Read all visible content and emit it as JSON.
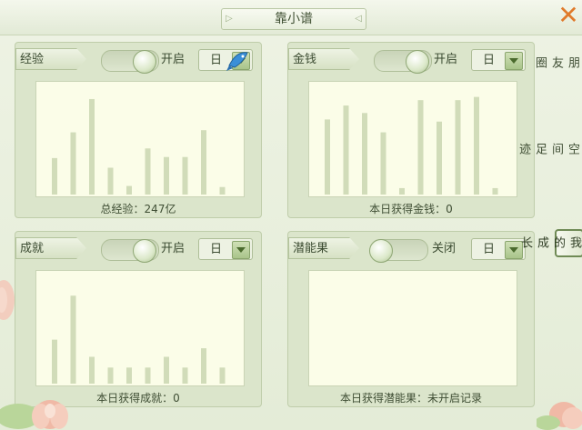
{
  "window": {
    "title": "靠小谱"
  },
  "side_tabs": [
    {
      "label": "朋友圈",
      "active": false
    },
    {
      "label": "空间足迹",
      "active": false
    },
    {
      "label": "我的成长",
      "active": true
    }
  ],
  "panels": {
    "exp": {
      "label": "经验",
      "toggle_label": "开启",
      "toggle_on": true,
      "period": "日",
      "caption": "总经验：247亿",
      "bars": [
        0.34,
        0.58,
        0.89,
        0.25,
        0.08,
        0.43,
        0.35,
        0.35,
        0.6,
        0.07
      ]
    },
    "money": {
      "label": "金钱",
      "toggle_label": "开启",
      "toggle_on": true,
      "period": "日",
      "caption": "本日获得金钱：0",
      "bars": [
        0.7,
        0.83,
        0.76,
        0.58,
        0.06,
        0.88,
        0.68,
        0.88,
        0.91,
        0.06
      ]
    },
    "achieve": {
      "label": "成就",
      "toggle_label": "开启",
      "toggle_on": true,
      "period": "日",
      "caption": "本日获得成就：0",
      "bars": [
        0.41,
        0.82,
        0.25,
        0.15,
        0.15,
        0.15,
        0.25,
        0.15,
        0.33,
        0.15
      ]
    },
    "potential": {
      "label": "潜能果",
      "toggle_label": "关闭",
      "toggle_on": false,
      "period": "日",
      "caption": "本日获得潜能果：未开启记录",
      "bars": []
    }
  },
  "colors": {
    "bar": "#d1dcb9",
    "accent": "#e07a2a"
  }
}
